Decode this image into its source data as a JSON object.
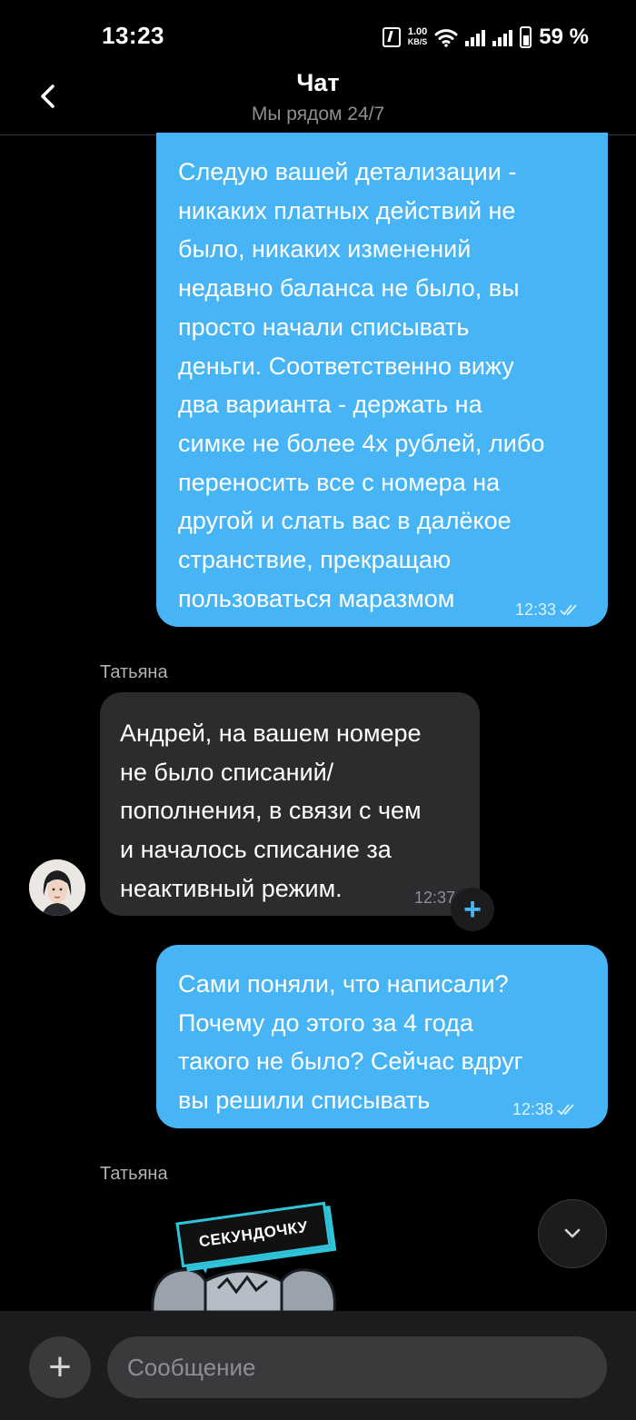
{
  "status_bar": {
    "time": "13:23",
    "net_speed_value": "1.00",
    "net_speed_unit": "KB/S",
    "battery": "59 %"
  },
  "header": {
    "back_icon": "chevron-left-icon",
    "title": "Чат",
    "subtitle": "Мы рядом 24/7"
  },
  "messages": [
    {
      "direction": "outgoing",
      "text": "Следую вашей детализации -\nникаких платных действий не\nбыло, никаких изменений\nнедавно баланса не было, вы\nпросто начали списывать\nденьги. Соответственно вижу\nдва варианта - держать на\nсимке не более 4х рублей, либо\nпереносить все с номера на\nдругой и слать вас в далёкое\nстранствие, прекращаю\nпользоваться маразмом",
      "time": "12:33",
      "status": "read"
    },
    {
      "direction": "incoming",
      "sender": "Татьяна",
      "text": "Андрей, на вашем номере\nне было списаний/\nпополнения, в связи с чем\nи началось списание за\nнеактивный режим.",
      "time": "12:37"
    },
    {
      "direction": "outgoing",
      "text": "Сами поняли, что написали?\nПочему до этого за 4 года\nтакого не было? Сейчас вдруг\nвы решили списывать",
      "time": "12:38",
      "status": "read"
    },
    {
      "direction": "incoming",
      "sender": "Татьяна",
      "sticker_text": "СЕКУНДОЧКУ"
    }
  ],
  "composer": {
    "placeholder": "Сообщение"
  },
  "colors": {
    "outgoing_bubble": "#47b5f5",
    "incoming_bubble": "#2c2c2e",
    "background": "#000000",
    "sticker_accent": "#2fc4d9"
  }
}
